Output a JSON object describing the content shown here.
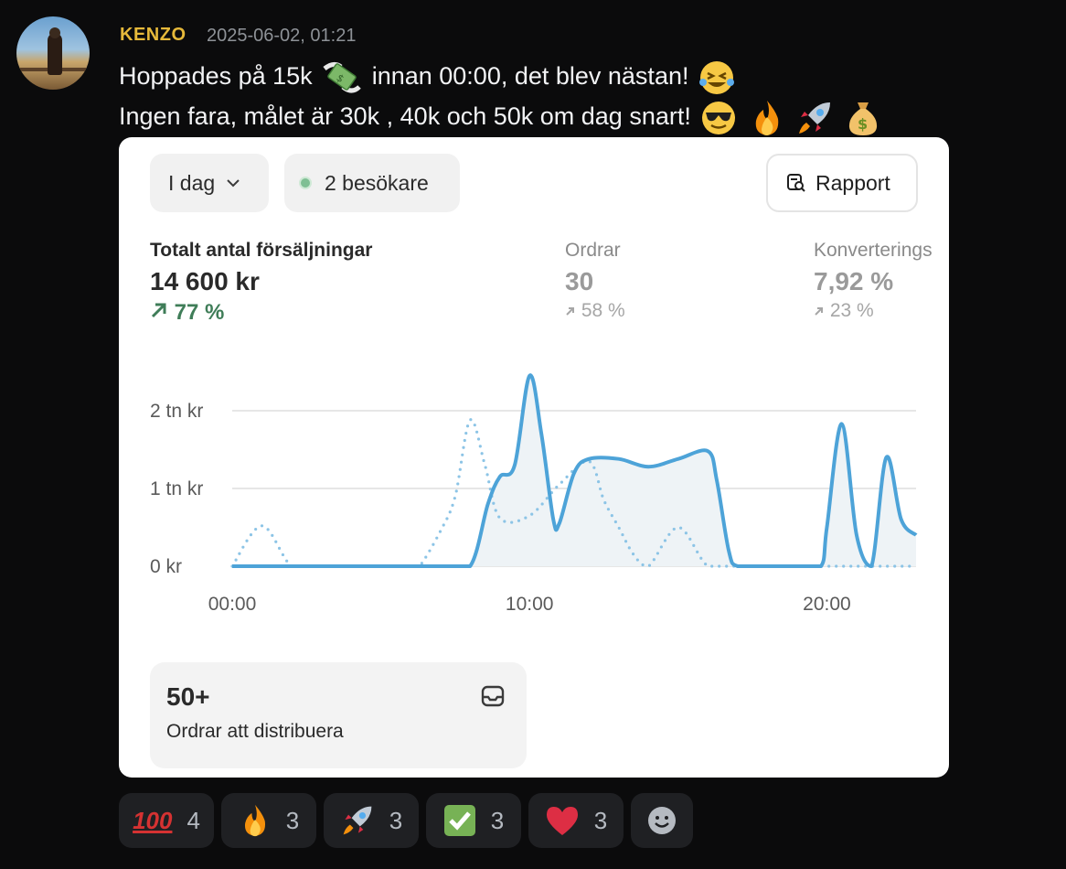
{
  "message": {
    "username": "KENZO",
    "timestamp": "2025-06-02, 01:21",
    "line1_a": "Hoppades på 15k",
    "line1_b": "innan 00:00, det blev nästan!",
    "line2": "Ingen fara, målet är 30k , 40k och 50k om dag snart!",
    "emoji": [
      "money-with-wings",
      "joy",
      "sunglasses",
      "fire",
      "rocket",
      "money-bag"
    ]
  },
  "card": {
    "range_label": "I dag",
    "visitors_label": "2 besökare",
    "report_label": "Rapport",
    "metrics": [
      {
        "label": "Totalt antal försäljningar",
        "value": "14 600 kr",
        "change": "77 %"
      },
      {
        "label": "Ordrar",
        "value": "30",
        "change": "58 %"
      },
      {
        "label": "Konverterings",
        "value": "7,92 %",
        "change": "23 %"
      }
    ],
    "box_value": "50+",
    "box_label": "Ordrar att distribuera"
  },
  "chart_data": {
    "type": "line",
    "y_ticks": [
      "2 tn kr",
      "1 tn kr",
      "0 kr"
    ],
    "x_ticks": [
      "00:00",
      "10:00",
      "20:00"
    ],
    "ylim": [
      0,
      2000
    ],
    "xlim": [
      0,
      23
    ],
    "grid": true,
    "series": [
      {
        "style": "solid",
        "x": [
          0,
          1,
          2,
          3,
          4,
          5,
          6,
          7,
          8,
          8.6,
          9,
          9.5,
          10,
          10.4,
          10.8,
          11,
          11.5,
          12,
          13,
          14,
          15,
          16,
          16.3,
          16.7,
          17,
          18,
          19,
          19.8,
          20,
          20.5,
          21,
          21.5,
          22,
          22.5,
          23
        ],
        "values": [
          0,
          0,
          0,
          0,
          0,
          0,
          0,
          0,
          0,
          800,
          1150,
          1300,
          2450,
          1700,
          600,
          550,
          1200,
          1380,
          1380,
          1280,
          1380,
          1480,
          1100,
          200,
          0,
          0,
          0,
          0,
          500,
          1830,
          400,
          0,
          1400,
          600,
          400
        ]
      },
      {
        "style": "dotted",
        "x": [
          0,
          1,
          2,
          3,
          4,
          5,
          6,
          6.3,
          7,
          7.5,
          8,
          8.5,
          9,
          10,
          11,
          12,
          12.5,
          13,
          13.5,
          14,
          15,
          16,
          17,
          18,
          19,
          20,
          21,
          22,
          23
        ],
        "values": [
          0,
          520,
          0,
          0,
          0,
          0,
          0,
          0,
          450,
          900,
          1880,
          1300,
          620,
          650,
          1050,
          1350,
          850,
          500,
          150,
          0,
          500,
          0,
          0,
          0,
          0,
          0,
          0,
          0,
          0
        ]
      }
    ]
  },
  "reactions": [
    {
      "emoji": "hundred-points",
      "count": "4"
    },
    {
      "emoji": "fire",
      "count": "3"
    },
    {
      "emoji": "rocket",
      "count": "3"
    },
    {
      "emoji": "check-mark-button",
      "count": "3"
    },
    {
      "emoji": "red-heart",
      "count": "3"
    }
  ],
  "colors": {
    "username": "#e6b93a",
    "chart_line": "#4da3d8",
    "positive": "#3f7d58"
  }
}
